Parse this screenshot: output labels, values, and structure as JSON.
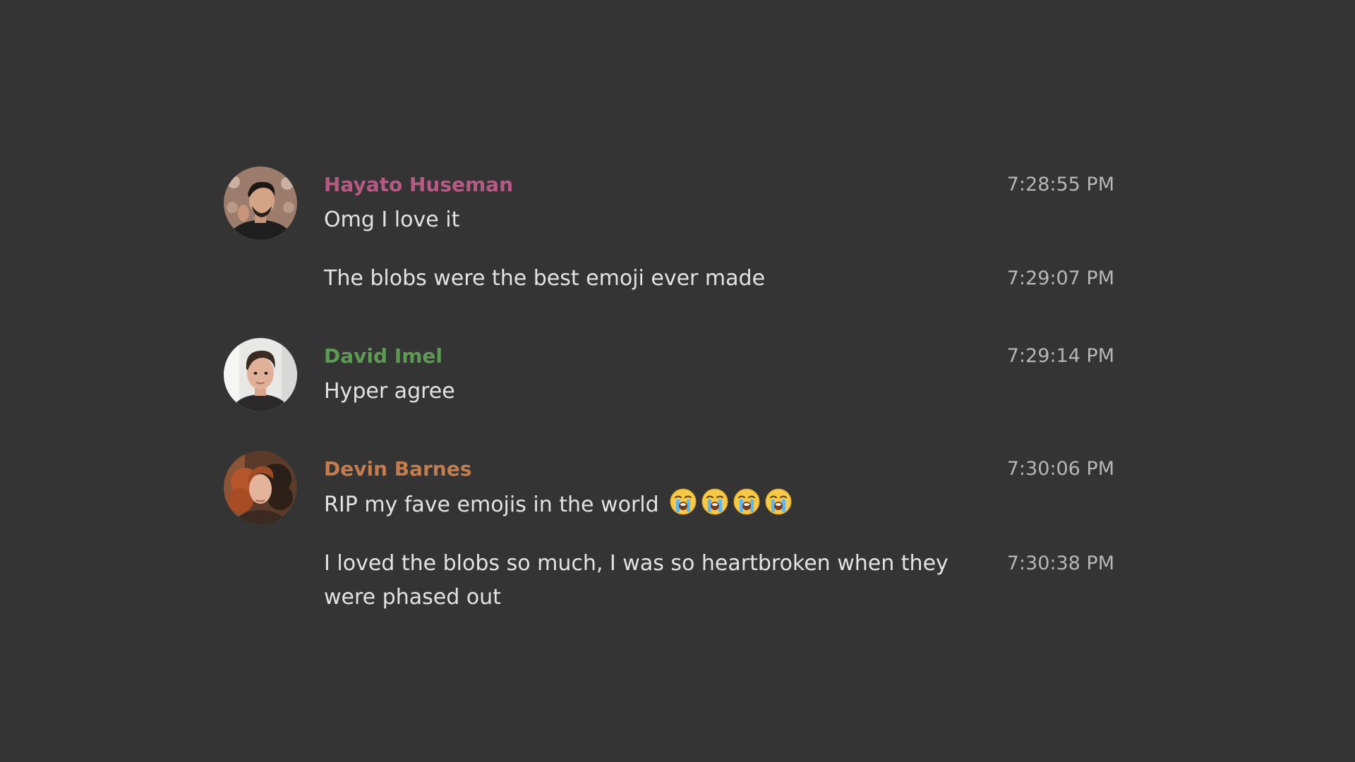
{
  "colors": {
    "background": "#343434",
    "message_text": "#e3e3e3",
    "timestamp": "#b6b6b6"
  },
  "messages": [
    {
      "author": "Hayato Huseman",
      "author_color": "#b55b82",
      "avatar": "avatar-man-dark-hair",
      "entries": [
        {
          "text": "Omg I love it",
          "time": "7:28:55 PM"
        },
        {
          "text": "The blobs were the best emoji ever made",
          "time": "7:29:07 PM"
        }
      ]
    },
    {
      "author": "David Imel",
      "author_color": "#5e9a53",
      "avatar": "avatar-young-man",
      "entries": [
        {
          "text": "Hyper agree",
          "time": "7:29:14 PM"
        }
      ]
    },
    {
      "author": "Devin Barnes",
      "author_color": "#c27c4e",
      "avatar": "avatar-woman-curly-red-hair",
      "entries": [
        {
          "text": "RIP my fave emojis in the world",
          "time": "7:30:06 PM",
          "emoji": [
            "loudly-crying-face-icon",
            "loudly-crying-face-icon",
            "loudly-crying-face-icon",
            "loudly-crying-face-icon"
          ]
        },
        {
          "text": "I loved the blobs so much, I was so heartbroken when they were phased out",
          "time": "7:30:38 PM"
        }
      ]
    }
  ]
}
